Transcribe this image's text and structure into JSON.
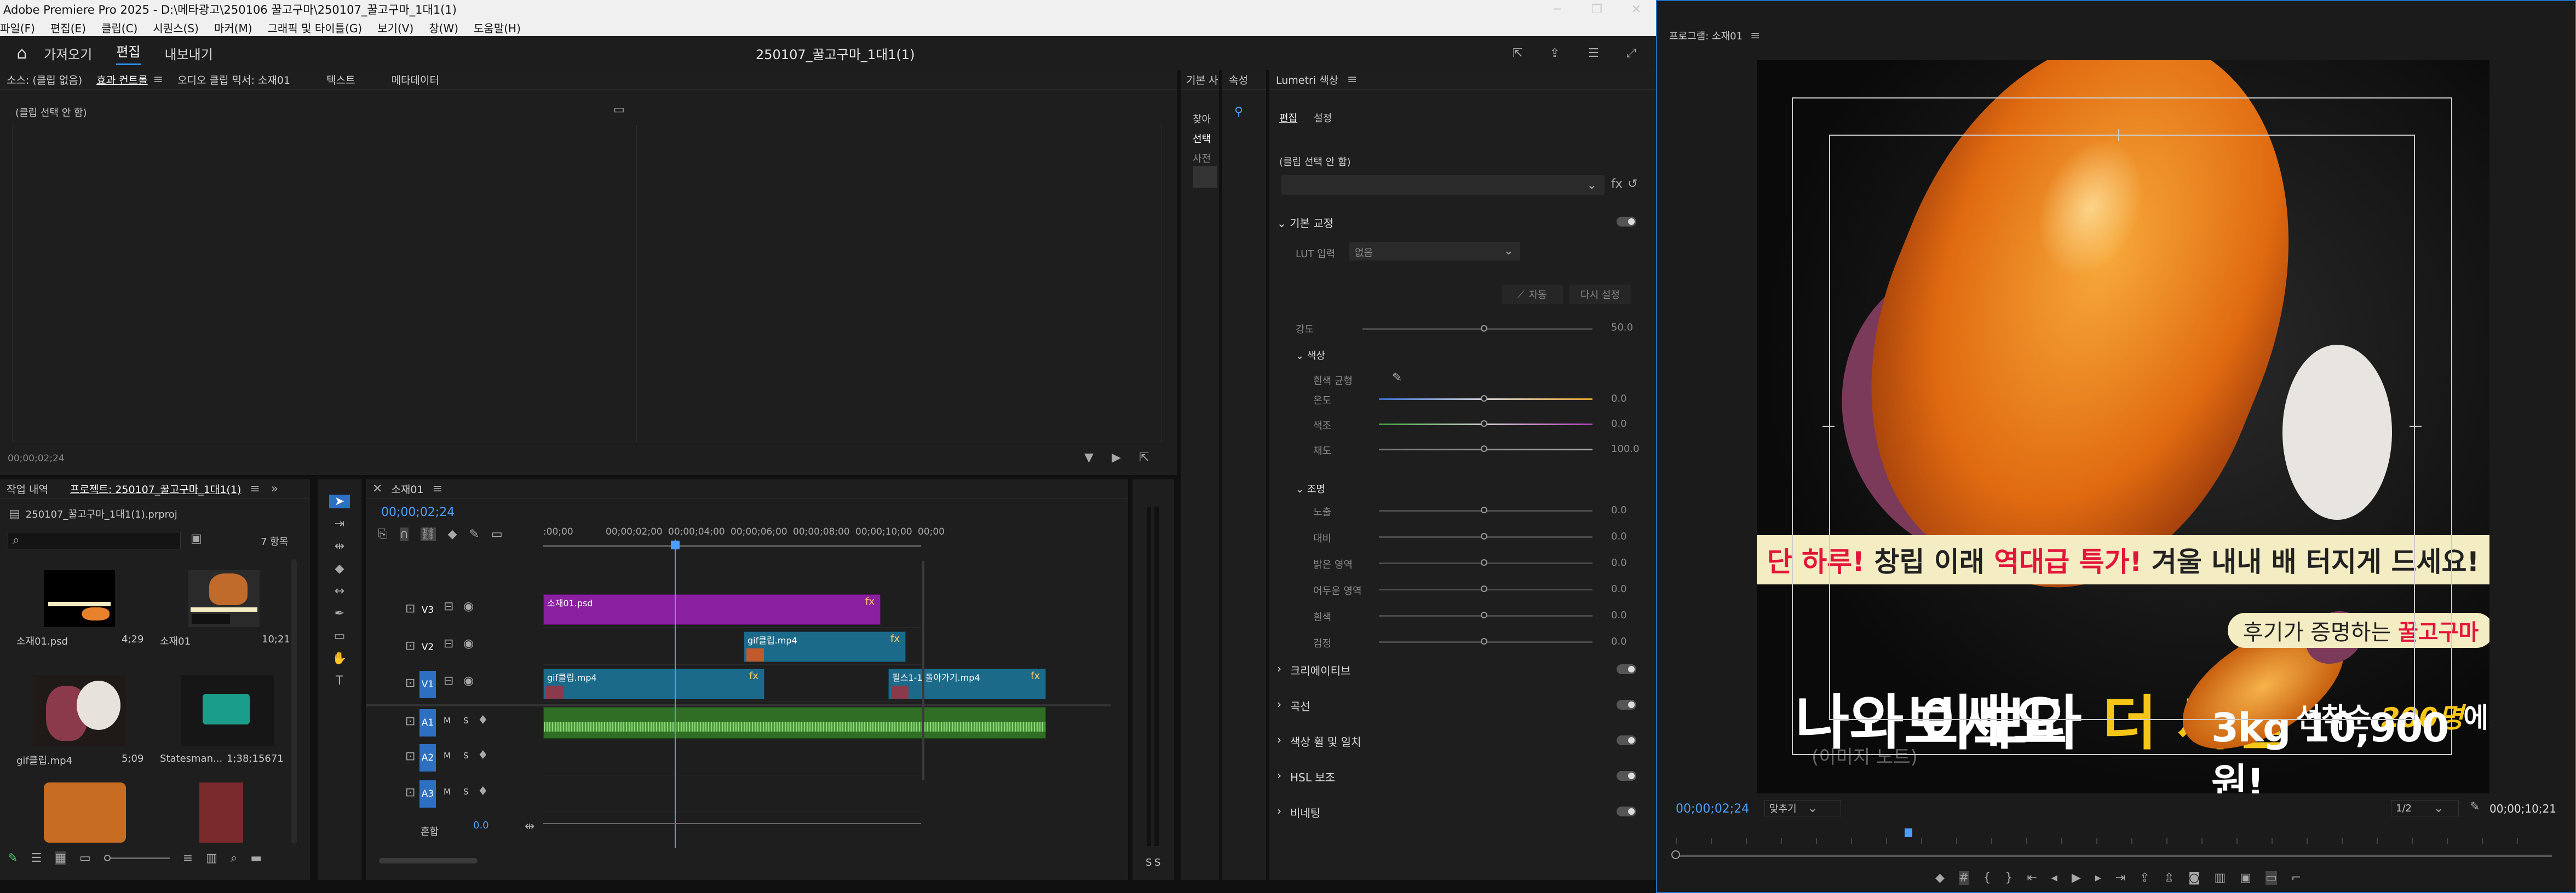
{
  "titlebar": {
    "title": "Adobe Premiere Pro 2025 - D:\\메타광고\\250106 꿀고구마\\250107_꿀고구마_1대1(1)"
  },
  "menu": [
    "파일(F)",
    "편집(E)",
    "클립(C)",
    "시퀀스(S)",
    "마커(M)",
    "그래픽 및 타이틀(G)",
    "보기(V)",
    "창(W)",
    "도움말(H)"
  ],
  "workspace": {
    "tabs": [
      "가져오기",
      "편집",
      "내보내기"
    ],
    "project_name": "250107_꿀고구마_1대1(1)"
  },
  "source_panel": {
    "tabs": [
      "소스: (클립 없음)",
      "효과 컨트롤",
      "오디오 클립 믹서: 소재01",
      "텍스트",
      "메타데이터"
    ],
    "no_clip": "(클립 선택 안 함)",
    "timecode": "00;00;02;24"
  },
  "mini_panel": {
    "tab": "기본 사",
    "items": [
      "찾아",
      "선택",
      "사전"
    ]
  },
  "props_panel": {
    "tab": "속성"
  },
  "project_panel": {
    "tabs": [
      "작업 내역",
      "프로젝트: 250107_꿀고구마_1대1(1)"
    ],
    "file": "250107_꿀고구마_1대1(1).prproj",
    "count": "7 항목",
    "items": [
      {
        "name": "소재01.psd",
        "duration": "4;29"
      },
      {
        "name": "소재01",
        "duration": "10;21"
      },
      {
        "name": "gif클립.mp4",
        "duration": "5;09"
      },
      {
        "name": "Statesman...",
        "duration": "1;38;15671"
      }
    ]
  },
  "timeline": {
    "tab": "소재01",
    "timecode": "00;00;02;24",
    "ruler": [
      ":00;00",
      "00;00;02;00",
      "00;00;04;00",
      "00;00;06;00",
      "00;00;08;00",
      "00;00;10;00",
      "00;00"
    ],
    "tracks": [
      "V3",
      "V2",
      "V1",
      "A1",
      "A2",
      "A3"
    ],
    "mix_label": "혼합",
    "mix_value": "0.0",
    "clips": [
      {
        "name": "소재01.psd",
        "fx": "fx"
      },
      {
        "name": "gif클립.mp4",
        "fx": "fx"
      },
      {
        "name": "gif클립.mp4",
        "fx": "fx"
      },
      {
        "name": "필스1-1 돌아가기.mp4",
        "fx": "fx"
      }
    ]
  },
  "lumetri": {
    "title": "Lumetri 색상",
    "tabs": [
      "편집",
      "설정"
    ],
    "no_clip": "(클립 선택 안 함)",
    "basic": "기본 교정",
    "lut_label": "LUT 입력",
    "lut_value": "없음",
    "auto": "자동",
    "reset": "다시 설정",
    "intensity_label": "강도",
    "intensity_value": "50.0",
    "color_section": "색상",
    "wb_label": "흰색 균형",
    "color_sliders": [
      {
        "label": "온도",
        "value": "0.0"
      },
      {
        "label": "색조",
        "value": "0.0"
      },
      {
        "label": "채도",
        "value": "100.0"
      }
    ],
    "light_section": "조명",
    "light_sliders": [
      {
        "label": "노출",
        "value": "0.0"
      },
      {
        "label": "대비",
        "value": "0.0"
      },
      {
        "label": "밝은 영역",
        "value": "0.0"
      },
      {
        "label": "어두운 영역",
        "value": "0.0"
      },
      {
        "label": "흰색",
        "value": "0.0"
      },
      {
        "label": "검정",
        "value": "0.0"
      }
    ],
    "sections": [
      "크리에이티브",
      "곡선",
      "색상 휠 및 일치",
      "HSL 보조",
      "비네팅"
    ]
  },
  "program": {
    "title": "프로그램: 소재01",
    "timecode": "00;00;02;24",
    "fit": "맞추기",
    "resolution": "1/2",
    "duration": "00;00;10;21",
    "banner": {
      "prefix": "단 하루!",
      "mid": " 창립 이래 ",
      "highlight": "역대급 특가!",
      "suffix": " 겨울 내내 배 터지게 드세요!"
    },
    "headline1a": "이보다 ",
    "headline1b": "더 싸면",
    "headline2": "나와보세요",
    "review_prefix": "후기가 증명하는 ",
    "review_brand": "꿀고구마",
    "offer_prefix": "선착순 ",
    "offer_count": "200명",
    "offer_suffix": "에게만",
    "price": "3kg 10,900원!",
    "watermark": "(이미지 노트)"
  },
  "colors": {
    "accent": "#2d8ceb",
    "v3": "#8a1fa0",
    "v1": "#1c6a8a",
    "audio": "#3a7a2c",
    "banner": "#f4ecc2",
    "red": "#e2163b",
    "yellow": "#f5c518",
    "playhead": "#4c9fff"
  }
}
